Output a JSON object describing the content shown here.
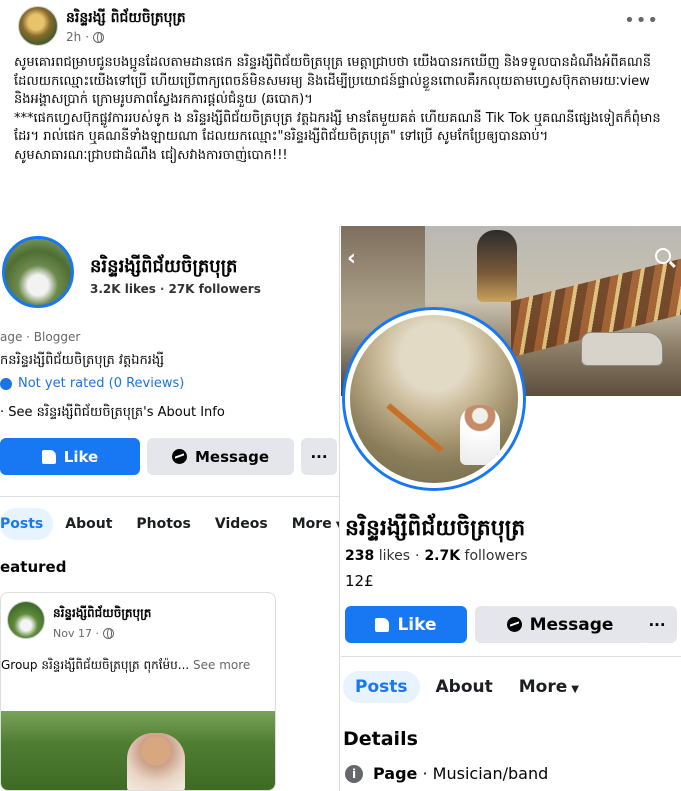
{
  "post": {
    "author": "នរិន្ទរង្សី ពិជ័យចិត្របុត្រ",
    "time": "2h",
    "paragraphs": [
      "សូមគោរពជម្រាបជូនបងប្អូនដែលតាមដានផេក នរិន្ទរង្សីពិជ័យចិត្របុត្រ មេត្តាជ្រាបថា យើងបានរកឃើញ និងទទួលបានដំណឹងអំពីគណនីដែលយកឈ្មោះយើងទៅប្រើ ហើយប្រើពាក្យពេចន៍មិនសមរម្យ និងដើម្បីប្រយោជន៍ផ្ទាល់ខ្លួនពោលគឺរកលុយតាមហ្វេសប៊ុកតាមរយៈview និងអង្គាសប្រាក់ ក្រោមរូបភាពស្វែងរកការផ្តល់ជំនួយ (ឆបោក)។",
      "***ផេកហ្វេសប៊ុកផ្លូវការរបស់ទូក ង នរិន្ទរង្សីពិជ័យចិត្របុត្រ វត្តឯករង្សី មានតែមួយគត់ ហើយគណនី Tik Tok ឬគណនីផ្សេងទៀតក៏ពុំមានដែរ។ រាល់ផេក ឬគណនីទាំងឡាយណា ដែលយកឈ្មោះ\"នរិន្ទរង្សីពិជ័យចិត្របុត្រ\" ទៅប្រើ សូមកែប្រែឲ្យបានឆាប់។",
      " សូមសាធារណៈជ្រាបជាដំណឹង ជៀសវាងការចាញ់បោក!!!"
    ]
  },
  "left_shot": {
    "page_name": "នរិន្ទរង្សីពិជ័យចិត្របុត្រ",
    "likes": "3.2K likes",
    "followers": "27K followers",
    "category": "age · Blogger",
    "subname": "កនរិន្ទរង្សីពិជ័យចិត្របុត្រ វត្តឯករង្សី",
    "rating": "Not yet rated (0 Reviews)",
    "about": "· See នរិន្ទរង្សីពិជ័យចិត្របុត្រ's About Info",
    "like_label": "Like",
    "message_label": "Message",
    "more_label": "···",
    "tabs": [
      "Posts",
      "About",
      "Photos",
      "Videos",
      "More"
    ],
    "featured": "eatured",
    "featured_post": {
      "author": "នរិន្ទរង្សីពិជ័យចិត្របុត្រ",
      "date": "Nov 17 ·",
      "text": "Group នរិន្ទរង្សីពិជ័យចិត្របុត្រ ពុកម៉ែប...",
      "see_more": "See more"
    }
  },
  "right_shot": {
    "page_name": "នរិន្ទរង្សីពិជ័យចិត្របុត្រ",
    "likes": "238",
    "likes_label": "likes",
    "followers": "2.7K",
    "followers_label": "followers",
    "extra": "12£",
    "like_label": "Like",
    "message_label": "Message",
    "more_label": "···",
    "tabs": [
      "Posts",
      "About",
      "More"
    ],
    "details_title": "Details",
    "page_type_label": "Page",
    "page_type_value": "Musician/band"
  },
  "icons": {
    "more": "more-dots-icon",
    "globe": "globe-icon",
    "back": "back-arrow-icon",
    "search": "search-icon",
    "info": "info-icon"
  },
  "colors": {
    "brand_blue": "#1877f2",
    "gray_button": "#e4e6eb",
    "meta_gray": "#65676b"
  }
}
